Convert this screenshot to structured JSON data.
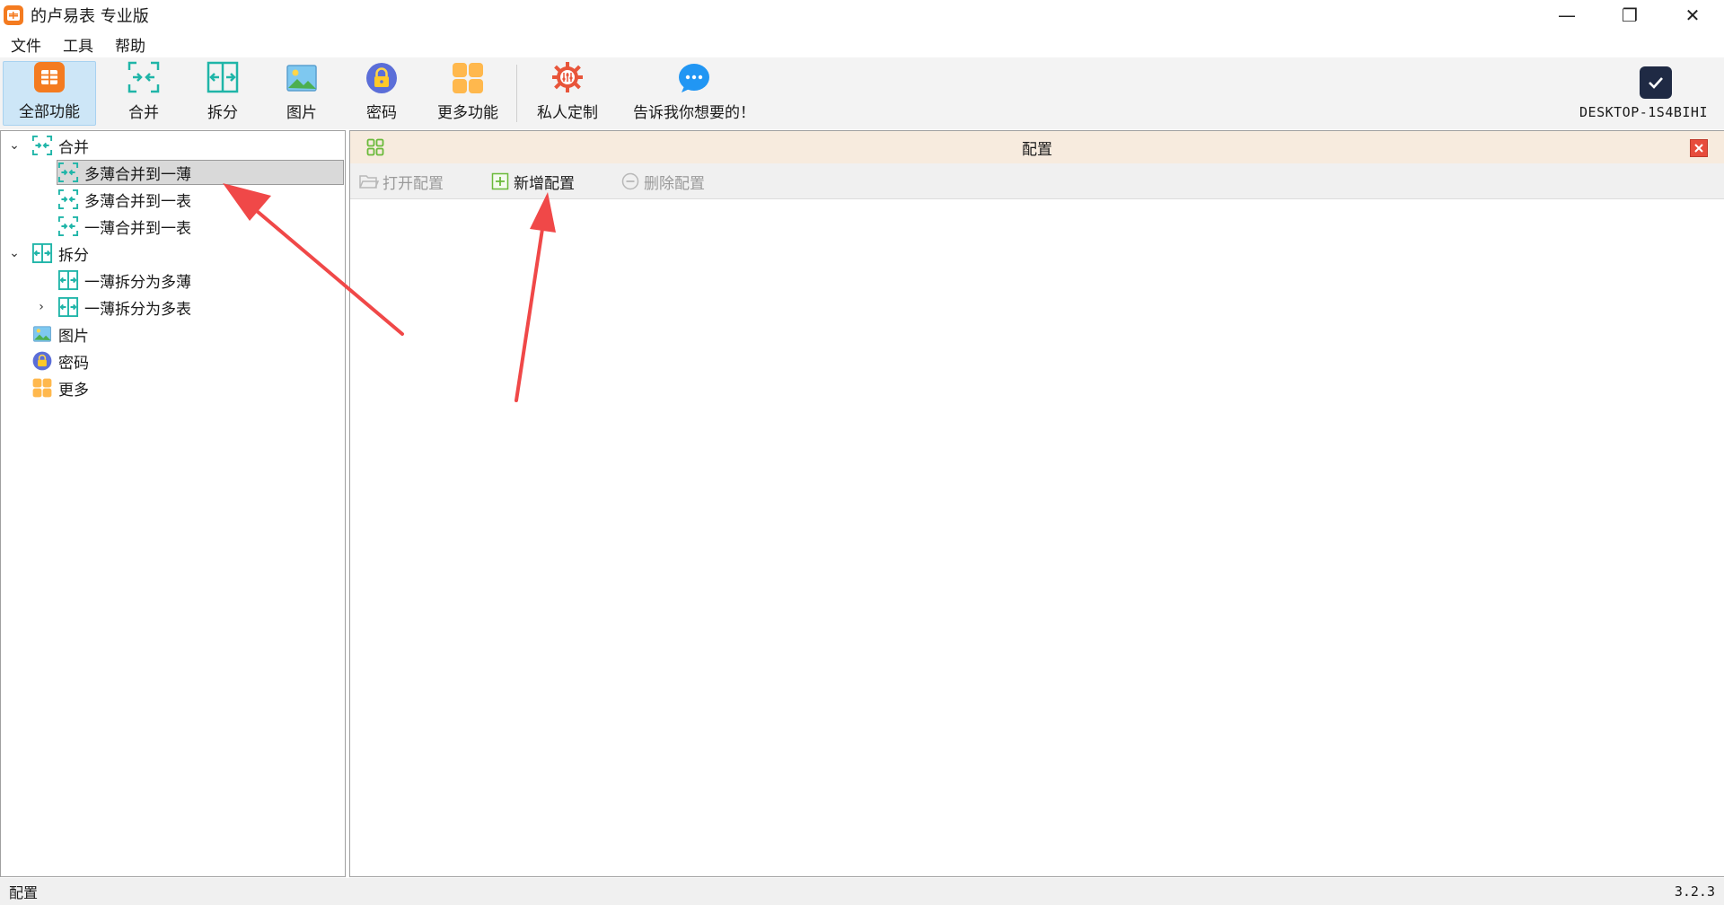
{
  "window": {
    "title": "的卢易表 专业版",
    "minimize_glyph": "—",
    "maximize_glyph": "❐",
    "close_glyph": "✕"
  },
  "menu": {
    "items": [
      "文件",
      "工具",
      "帮助"
    ]
  },
  "toolbar": {
    "items": [
      {
        "label": "全部功能",
        "icon": "app-grid-icon",
        "active": true
      },
      {
        "label": "合并",
        "icon": "merge-icon"
      },
      {
        "label": "拆分",
        "icon": "split-icon"
      },
      {
        "label": "图片",
        "icon": "image-icon"
      },
      {
        "label": "密码",
        "icon": "lock-icon"
      },
      {
        "label": "更多功能",
        "icon": "more-grid-icon"
      },
      {
        "label": "私人定制",
        "icon": "custom-gear-icon"
      },
      {
        "label": "告诉我你想要的！",
        "icon": "chat-bubble-icon"
      }
    ],
    "user": {
      "label": "DESKTOP-1S4BIHI",
      "icon": "checkmark-icon"
    }
  },
  "tree": {
    "nodes": [
      {
        "label": "合并",
        "icon": "merge-icon",
        "expanded": true
      },
      {
        "label": "多薄合并到一薄",
        "icon": "merge-icon",
        "selected": true
      },
      {
        "label": "多薄合并到一表",
        "icon": "merge-icon"
      },
      {
        "label": "一薄合并到一表",
        "icon": "merge-icon"
      },
      {
        "label": "拆分",
        "icon": "split-icon",
        "expanded": true
      },
      {
        "label": "一薄拆分为多薄",
        "icon": "split-icon"
      },
      {
        "label": "一薄拆分为多表",
        "icon": "split-icon",
        "expanded": false
      },
      {
        "label": "图片",
        "icon": "image-icon"
      },
      {
        "label": "密码",
        "icon": "lock-icon"
      },
      {
        "label": "更多",
        "icon": "more-grid-icon"
      }
    ]
  },
  "content": {
    "title": "配置",
    "actions": {
      "open": {
        "label": "打开配置",
        "enabled": false
      },
      "add": {
        "label": "新增配置",
        "enabled": true
      },
      "delete": {
        "label": "删除配置",
        "enabled": false
      }
    }
  },
  "statusbar": {
    "left": "配置",
    "version": "3.2.3"
  },
  "colors": {
    "accent_orange": "#f47b20",
    "merge_teal": "#1fb5a8",
    "arrow_red": "#f04848",
    "header_bg": "#f7ebde",
    "selection": "#d9d9d9"
  }
}
